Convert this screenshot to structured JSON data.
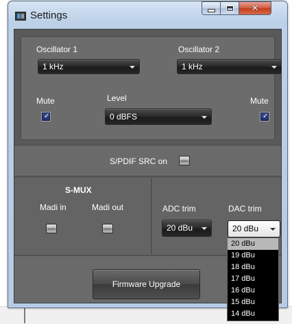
{
  "window": {
    "title": "Settings",
    "controls": {
      "minimize": "minimize-button",
      "maximize": "maximize-button",
      "close": "close-button"
    }
  },
  "oscillator1": {
    "label": "Oscillator 1",
    "value": "1 kHz"
  },
  "oscillator2": {
    "label": "Oscillator 2",
    "value": "1 kHz"
  },
  "mute_left": {
    "label": "Mute",
    "checked": true
  },
  "mute_right": {
    "label": "Mute",
    "checked": true
  },
  "level": {
    "label": "Level",
    "value": "0 dBFS"
  },
  "spdif": {
    "label": "S/PDIF SRC on"
  },
  "smux": {
    "title": "S-MUX",
    "madi_in": "Madi in",
    "madi_out": "Madi out"
  },
  "adc_trim": {
    "label": "ADC trim",
    "value": "20 dBu"
  },
  "dac_trim": {
    "label": "DAC trim",
    "value": "20 dBu",
    "options": [
      "20 dBu",
      "19 dBu",
      "18 dBu",
      "17 dBu",
      "16 dBu",
      "15 dBu",
      "14 dBu"
    ],
    "selected_index": 0
  },
  "firmware": {
    "label": "Firmware Upgrade"
  },
  "icons": {
    "checkmark": "✓",
    "close": "✕"
  },
  "colors": {
    "panel": "#6c6c6c",
    "checkbox": "#2a3b7f",
    "dropdown_bg": "#000000"
  }
}
